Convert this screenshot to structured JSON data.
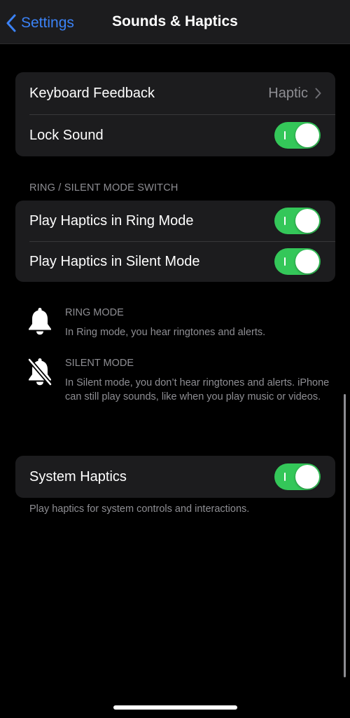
{
  "navbar": {
    "back_label": "Settings",
    "title": "Sounds & Haptics"
  },
  "group1": {
    "keyboard_feedback": {
      "label": "Keyboard Feedback",
      "value": "Haptic"
    },
    "lock_sound": {
      "label": "Lock Sound",
      "on": true
    }
  },
  "ring_silent": {
    "header": "RING / SILENT MODE SWITCH",
    "ring_mode_haptics": {
      "label": "Play Haptics in Ring Mode",
      "on": true
    },
    "silent_mode_haptics": {
      "label": "Play Haptics in Silent Mode",
      "on": true
    }
  },
  "info": {
    "ring_mode": {
      "icon": "bell-icon",
      "title": "RING MODE",
      "text": "In Ring mode, you hear ringtones and alerts."
    },
    "silent_mode": {
      "icon": "bell-slash-icon",
      "title": "SILENT MODE",
      "text": "In Silent mode, you don’t hear ringtones and alerts. iPhone can still play sounds, like when you play music or videos."
    }
  },
  "system_haptics": {
    "label": "System Haptics",
    "on": true,
    "footer": "Play haptics for system controls and interactions."
  },
  "colors": {
    "accent": "#3b82f6",
    "toggle_on": "#34c759",
    "cell_bg": "#1c1c1e",
    "secondary_text": "#8e8e93"
  }
}
